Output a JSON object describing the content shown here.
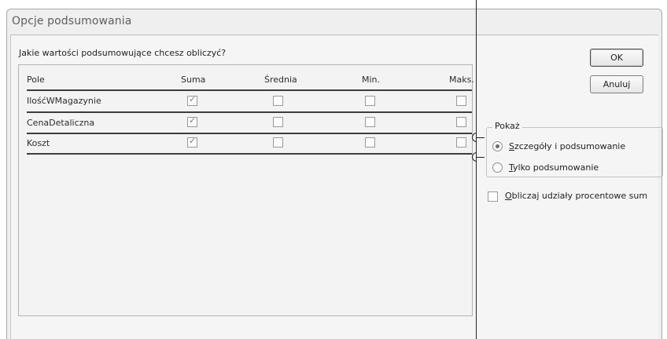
{
  "window": {
    "title": "Opcje podsumowania"
  },
  "prompt": "Jakie wartości podsumowujące chcesz obliczyć?",
  "table": {
    "columns": [
      "Pole",
      "Suma",
      "Średnia",
      "Min.",
      "Maks."
    ],
    "rows": [
      {
        "field": "IlośćWMagazynie",
        "suma": true,
        "srednia": false,
        "min": false,
        "maks": false
      },
      {
        "field": "CenaDetaliczna",
        "suma": true,
        "srednia": false,
        "min": false,
        "maks": false
      },
      {
        "field": "Koszt",
        "suma": true,
        "srednia": false,
        "min": false,
        "maks": false
      }
    ]
  },
  "buttons": {
    "ok": "OK",
    "cancel": "Anuluj"
  },
  "show_group": {
    "legend": "Pokaż",
    "options": [
      {
        "label_prefix": "",
        "label_underlined": "S",
        "label_rest": "zczegóły i podsumowanie",
        "selected": true
      },
      {
        "label_prefix": "",
        "label_underlined": "T",
        "label_rest": "ylko podsumowanie",
        "selected": false
      }
    ]
  },
  "percent_checkbox": {
    "label_underlined": "O",
    "label_rest": "bliczaj udziały procentowe sum",
    "checked": false
  },
  "icons": {
    "check": "check-mark-icon"
  }
}
